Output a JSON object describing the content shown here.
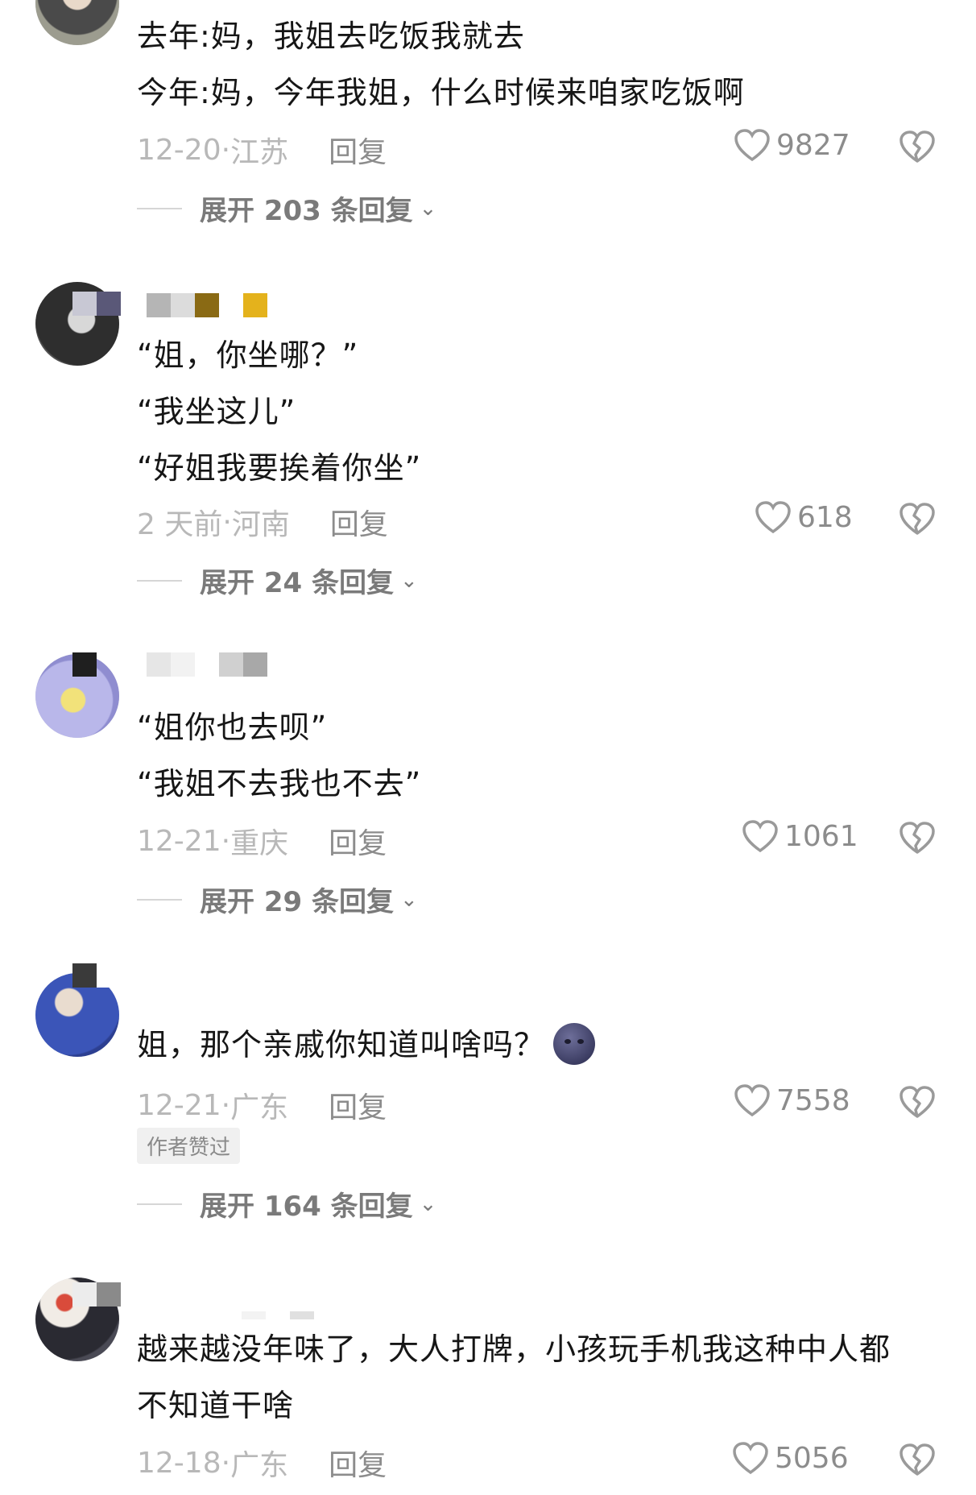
{
  "comments": [
    {
      "lines": [
        "去年:妈，我姐去吃饭我就去",
        "今年:妈，今年我姐，什么时候来咱家吃饭啊"
      ],
      "date": "12-20",
      "sep": "·",
      "location": "江苏",
      "reply_label": "回复",
      "likes": "9827",
      "expand_label": "展开 203 条回复"
    },
    {
      "lines": [
        "“姐，你坐哪？”",
        "“我坐这儿”",
        "“好姐我要挨着你坐”"
      ],
      "date": "2 天前",
      "sep": " · ",
      "location": "河南",
      "reply_label": "回复",
      "likes": "618",
      "expand_label": "展开 24 条回复"
    },
    {
      "lines": [
        "“姐你也去呗”",
        "“我姐不去我也不去”"
      ],
      "date": "12-21",
      "sep": "·",
      "location": "重庆",
      "reply_label": "回复",
      "likes": "1061",
      "expand_label": "展开 29 条回复"
    },
    {
      "lines": [
        "姐，那个亲戚你知道叫啥吗？"
      ],
      "emoji": "new-moon-face-emoji",
      "date": "12-21",
      "sep": "·",
      "location": "广东",
      "reply_label": "回复",
      "likes": "7558",
      "badge": "作者赞过",
      "expand_label": "展开 164 条回复"
    },
    {
      "lines": [
        "越来越没年味了，大人打牌，小孩玩手机我这种中人都",
        "不知道干啥"
      ],
      "date": "12-18",
      "sep": "·",
      "location": "广东",
      "reply_label": "回复",
      "likes": "5056"
    }
  ],
  "icons": {
    "like": "heart-outline-icon",
    "dislike": "broken-heart-icon",
    "expand": "chevron-down-icon"
  },
  "colors": {
    "text": "#161616",
    "meta": "#b8b8b8",
    "secondary": "#8c8c8c"
  }
}
